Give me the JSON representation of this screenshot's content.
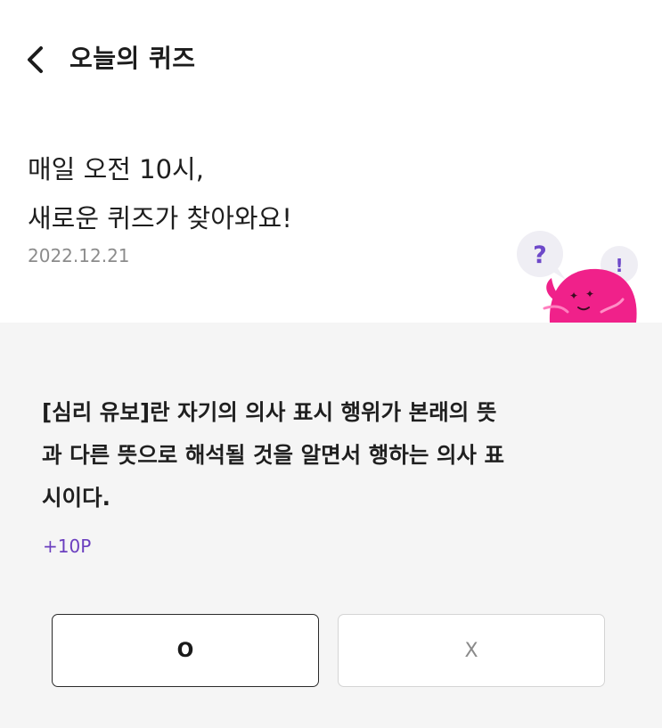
{
  "header": {
    "title": "오늘의 퀴즈",
    "back_icon": "chevron-left-icon"
  },
  "hero": {
    "line1": "매일 오전 10시,",
    "line2": "새로운 퀴즈가 찾아와요!",
    "date": "2022.12.21",
    "mascot_question_mark": "?",
    "mascot_exclamation_mark": "!"
  },
  "quiz": {
    "question_lines": [
      "[심리 유보]란 자기의 의사 표시 행위가 본래의 뜻",
      "과 다른 뜻으로 해석될 것을 알면서 행하는 의사 표",
      "시이다."
    ],
    "points": "+10P",
    "answers": {
      "o_label": "O",
      "x_label": "X"
    }
  },
  "colors": {
    "accent_purple": "#6b3fbf",
    "mascot_pink": "#f0218a",
    "quiz_background": "#f5f5f5"
  }
}
